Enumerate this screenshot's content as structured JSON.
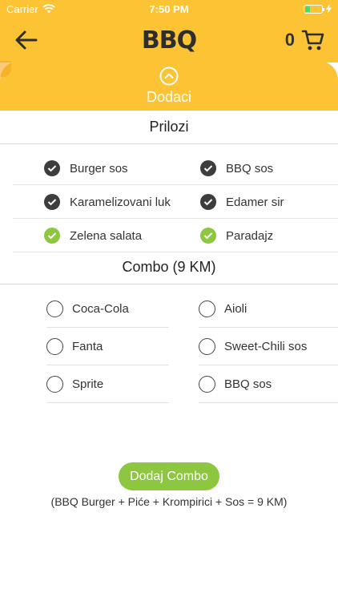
{
  "status_bar": {
    "carrier": "Carrier",
    "time": "7:50 PM"
  },
  "header": {
    "logo": "BBQ",
    "cart_count": "0"
  },
  "section": {
    "title": "Dodaci"
  },
  "prilozi": {
    "title": "Prilozi",
    "rows": [
      [
        {
          "label": "Burger sos",
          "style": "dark"
        },
        {
          "label": "BBQ sos",
          "style": "dark"
        }
      ],
      [
        {
          "label": "Karamelizovani luk",
          "style": "dark"
        },
        {
          "label": "Edamer sir",
          "style": "dark"
        }
      ],
      [
        {
          "label": "Zelena salata",
          "style": "green"
        },
        {
          "label": "Paradajz",
          "style": "green"
        }
      ]
    ]
  },
  "combo": {
    "title": "Combo (9 KM)",
    "drinks": [
      "Coca-Cola",
      "Fanta",
      "Sprite"
    ],
    "sauces": [
      "Aioli",
      "Sweet-Chili sos",
      "BBQ sos"
    ],
    "button": "Dodaj Combo",
    "note": "(BBQ Burger + Piće + Krompirici + Sos = 9 KM)"
  },
  "colors": {
    "accent": "#fcc434",
    "green": "#8dc63f",
    "dark_check": "#3d3d3d"
  },
  "icons": {
    "back": "arrow-left-icon",
    "cart": "cart-icon",
    "chevron": "chevron-up-circle-icon",
    "wifi": "wifi-icon",
    "battery": "battery-icon",
    "charging": "charging-icon"
  }
}
